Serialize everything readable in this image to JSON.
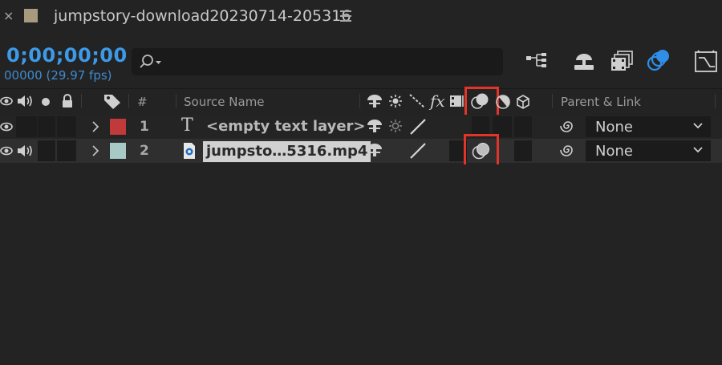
{
  "tab": {
    "close_glyph": "×",
    "title": "jumpstory-download20230714-205316",
    "swatch_color": "#a89a7e"
  },
  "header": {
    "timecode": "0;00;00;00",
    "frame_readout": "00000 (29.97 fps)",
    "search": {
      "value": "",
      "placeholder": ""
    },
    "buttons": [
      "composition-flowchart-icon",
      "draft-3d-icon",
      "frame-blending-icon",
      "motion-blur-icon",
      "graph-editor-icon"
    ]
  },
  "columns": {
    "hash": "#",
    "source_name": "Source Name",
    "fx": "fx",
    "parent_link": "Parent & Link"
  },
  "layers": [
    {
      "number": "1",
      "type_glyph": "T",
      "name": "<empty text layer>",
      "label_color": "#c0393b",
      "parent": "None",
      "motion_blur_highlighted": false
    },
    {
      "number": "2",
      "type_glyph": "video-file-icon",
      "name": "jumpsto…5316.mp4",
      "label_color": "#a7cac6",
      "parent": "None",
      "motion_blur_highlighted": true
    }
  ],
  "highlight_color": "#e3342a"
}
